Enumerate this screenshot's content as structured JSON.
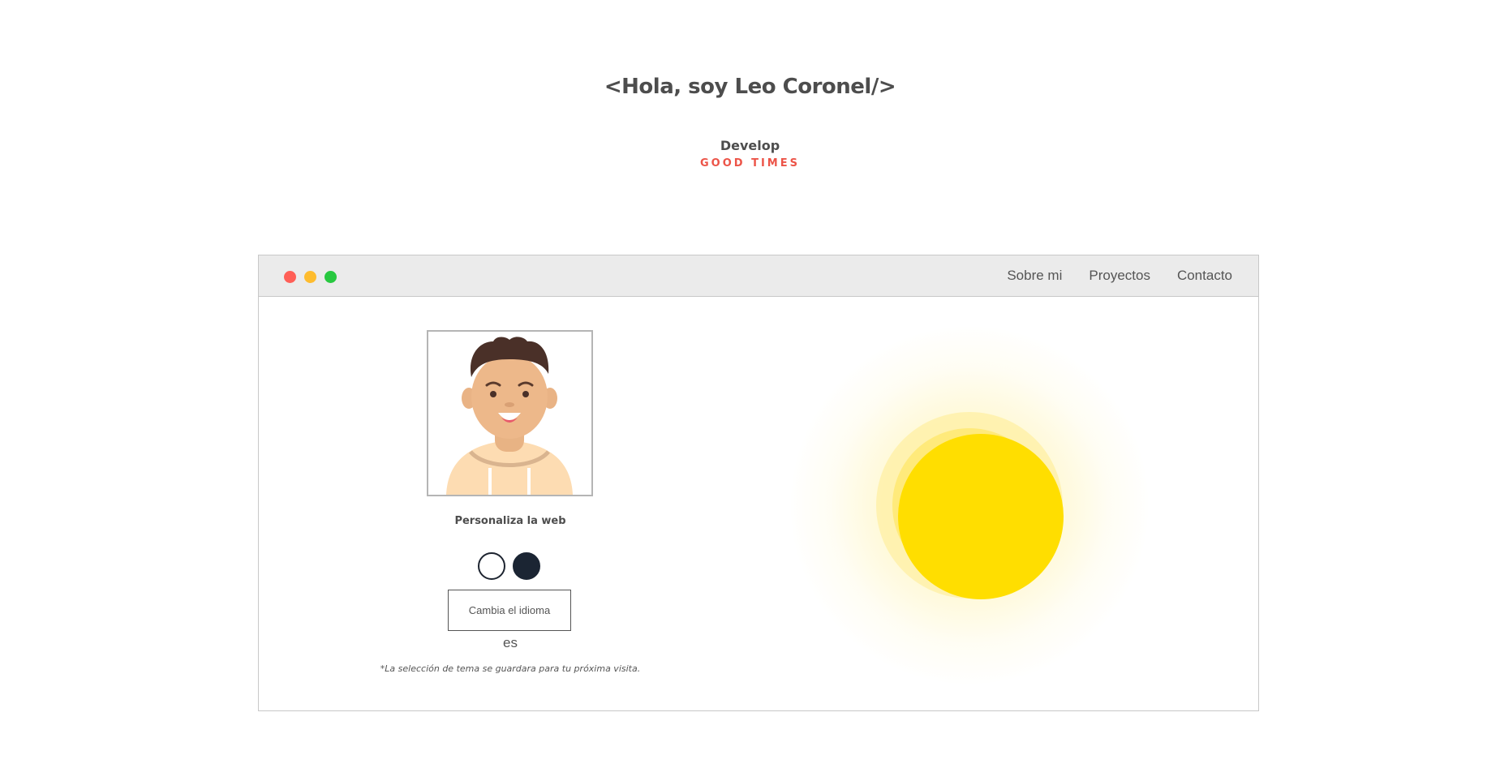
{
  "hero": {
    "title": "<Hola, soy Leo Coronel/>",
    "subtitle": "Develop",
    "tagline": "GOOD TIMES"
  },
  "nav": {
    "items": [
      {
        "label": "Sobre mi"
      },
      {
        "label": "Proyectos"
      },
      {
        "label": "Contacto"
      }
    ]
  },
  "settings": {
    "customize_label": "Personaliza la web",
    "language_button": "Cambia el idioma",
    "language_value": "es",
    "note": "*La selección de tema se guardara para tu próxima visita.",
    "themes": [
      "light",
      "dark"
    ]
  },
  "colors": {
    "accent": "#ec5448",
    "sun": "#ffde00",
    "dark_theme": "#1b2533"
  },
  "icons": {
    "avatar": "avatar-illustration",
    "sun": "sun-icon"
  }
}
